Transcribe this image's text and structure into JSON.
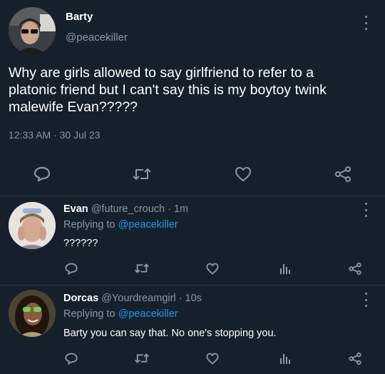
{
  "main_tweet": {
    "display_name": "Barty",
    "handle": "@peacekiller",
    "text": "Why are girls allowed to say girlfriend to refer to a platonic friend but I can't say this is my boytoy twink malewife Evan?????",
    "time": "12:33 AM",
    "separator": "·",
    "date": "30 Jul 23"
  },
  "replies": [
    {
      "display_name": "Evan",
      "handle": "@future_crouch",
      "age": "· 1m",
      "replying_prefix": "Replying to",
      "replying_to": "@peacekiller",
      "text": "??????"
    },
    {
      "display_name": "Dorcas",
      "handle": "@Yourdreamgirl",
      "age": "· 10s",
      "replying_prefix": "Replying to",
      "replying_to": "@peacekiller",
      "text": "Barty you can say that. No one's stopping you."
    }
  ],
  "icons": {
    "reply": "reply-icon",
    "retweet": "retweet-icon",
    "like": "heart-icon",
    "share": "share-icon",
    "analytics": "analytics-icon",
    "menu": "more-vertical-icon"
  },
  "colors": {
    "background": "#15202b",
    "text": "#ffffff",
    "muted": "#8b98a5",
    "link": "#1d9bf0",
    "divider": "#2f3b47"
  }
}
